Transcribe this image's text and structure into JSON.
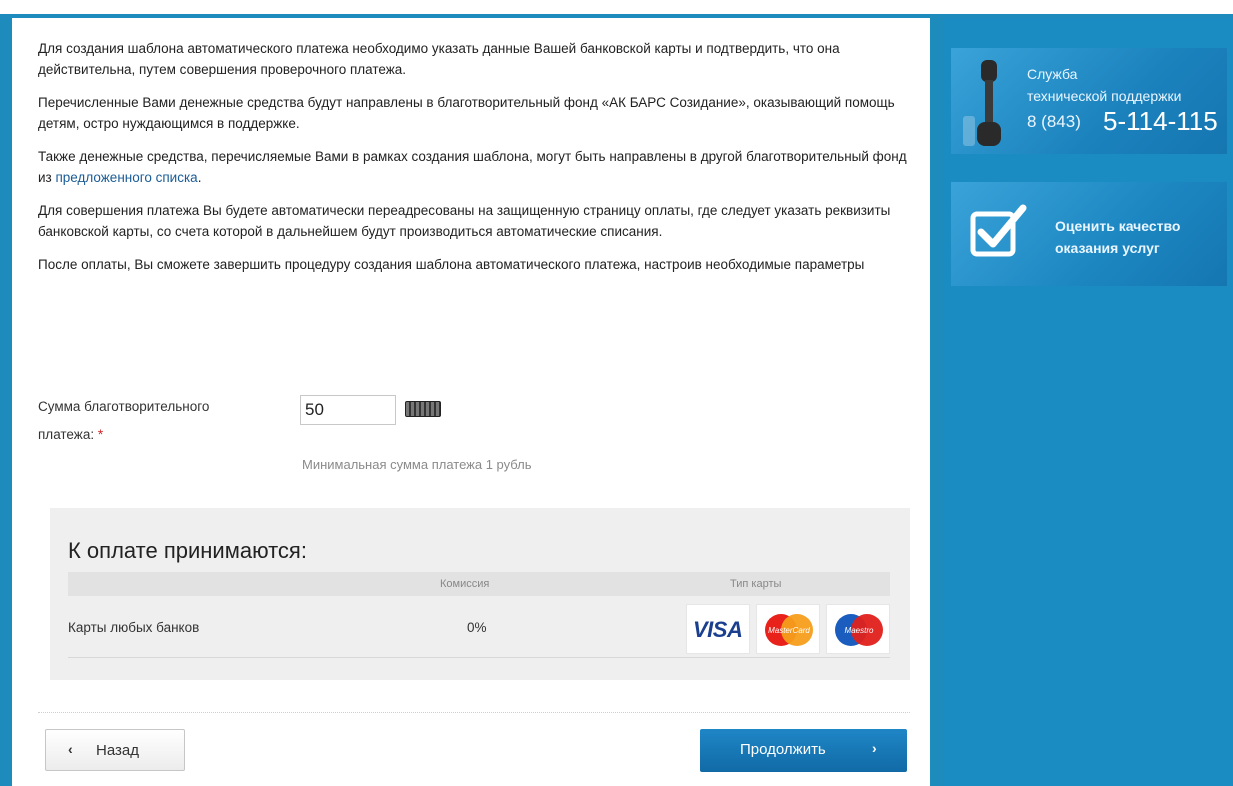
{
  "intro": {
    "p1": "Для создания шаблона автоматического платежа необходимо указать данные Вашей банковской карты и подтвердить, что она действительна, путем совершения проверочного платежа.",
    "p2": "Перечисленные Вами денежные средства будут направлены в благотворительный фонд «АК БАРС Созидание», оказывающий помощь детям, остро нуждающимся в поддержке.",
    "p3_before_link": "Также денежные средства, перечисляемые Вами в рамках создания шаблона, могут быть направлены в другой благотворительный фонд из ",
    "p3_link": "предложенного списка",
    "p3_after_link": ".",
    "p4": "Для совершения платежа Вы будете автоматически переадресованы на защищенную страницу оплаты, где следует указать реквизиты банковской карты, со счета которой в дальнейшем будут производиться автоматические списания.",
    "p5": "После оплаты, Вы сможете завершить процедуру создания шаблона автоматического платежа, настроив необходимые параметры"
  },
  "amount": {
    "label_line1": "Сумма благотворительного",
    "label_line2": "платежа:",
    "required_mark": "*",
    "value": "50",
    "hint": "Минимальная сумма платежа 1 рубль"
  },
  "payments": {
    "title": "К оплате принимаются:",
    "col_commission": "Комиссия",
    "col_card_type": "Тип карты",
    "rows": [
      {
        "bank": "Карты любых банков",
        "commission": "0%",
        "cards": [
          "visa",
          "mastercard",
          "maestro"
        ]
      }
    ],
    "visa_label": "VISA",
    "mastercard_label": "MasterCard",
    "maestro_label": "Maestro"
  },
  "buttons": {
    "back": "Назад",
    "continue": "Продолжить"
  },
  "sidebar": {
    "support_line1": "Служба",
    "support_line2": "технической поддержки",
    "support_phone_prefix": "8 (843)",
    "support_phone_main": "5-114-115",
    "rate_line1": "Оценить качество",
    "rate_line2": "оказания услуг"
  },
  "colors": {
    "page_bg": "#1e8bbd",
    "accent_button": "#116aa6",
    "required": "#d0232a",
    "link": "#1a5c96"
  }
}
